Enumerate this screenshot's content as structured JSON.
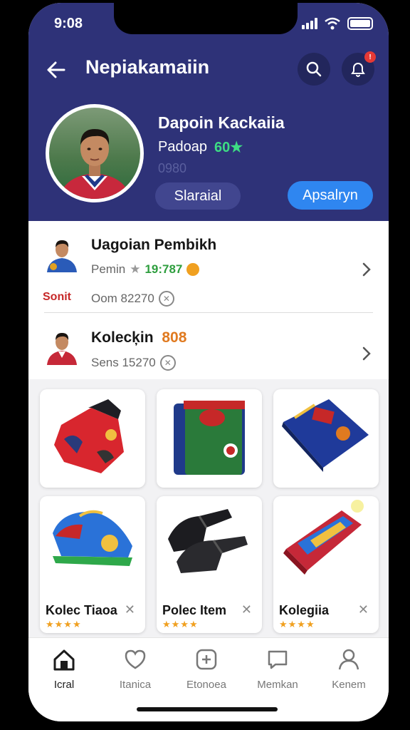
{
  "status": {
    "time": "9:08"
  },
  "header": {
    "title": "Nepiakamaiin"
  },
  "profile": {
    "name": "Dapoin Kackaiia",
    "subtitle": "Padoap",
    "rating": "60★",
    "id": "0980",
    "secondary_button": "Slaraial",
    "primary_button": "Apsalryn"
  },
  "list": [
    {
      "title": "Uagoian Pembikh",
      "meta_label": "Pemin",
      "meta_value": "19:787",
      "meta2": "Oom 82270",
      "badge": "Sonit"
    },
    {
      "title": "Kolecķin",
      "title_accent": "808",
      "meta2": "Sens 15270"
    }
  ],
  "grid": [
    {
      "name": "jersey"
    },
    {
      "name": "wallet-green"
    },
    {
      "name": "wallet-blue"
    },
    {
      "name": "shoe",
      "label": "Kolec Tiaoa",
      "stars": "★★★★"
    },
    {
      "name": "gloves",
      "label": "Polec Item",
      "stars": "★★★★"
    },
    {
      "name": "scarf",
      "label": "Kolegiia",
      "stars": "★★★★"
    }
  ],
  "tabs": [
    {
      "label": "Icral",
      "icon": "home-icon"
    },
    {
      "label": "Itanica",
      "icon": "heart-icon"
    },
    {
      "label": "Etonoea",
      "icon": "grid-icon"
    },
    {
      "label": "Memkan",
      "icon": "chat-icon"
    },
    {
      "label": "Kenem",
      "icon": "user-icon"
    }
  ],
  "colors": {
    "header": "#2e3278",
    "primary": "#2f86f0",
    "rating": "#3ddc84",
    "badge": "#e53935"
  }
}
